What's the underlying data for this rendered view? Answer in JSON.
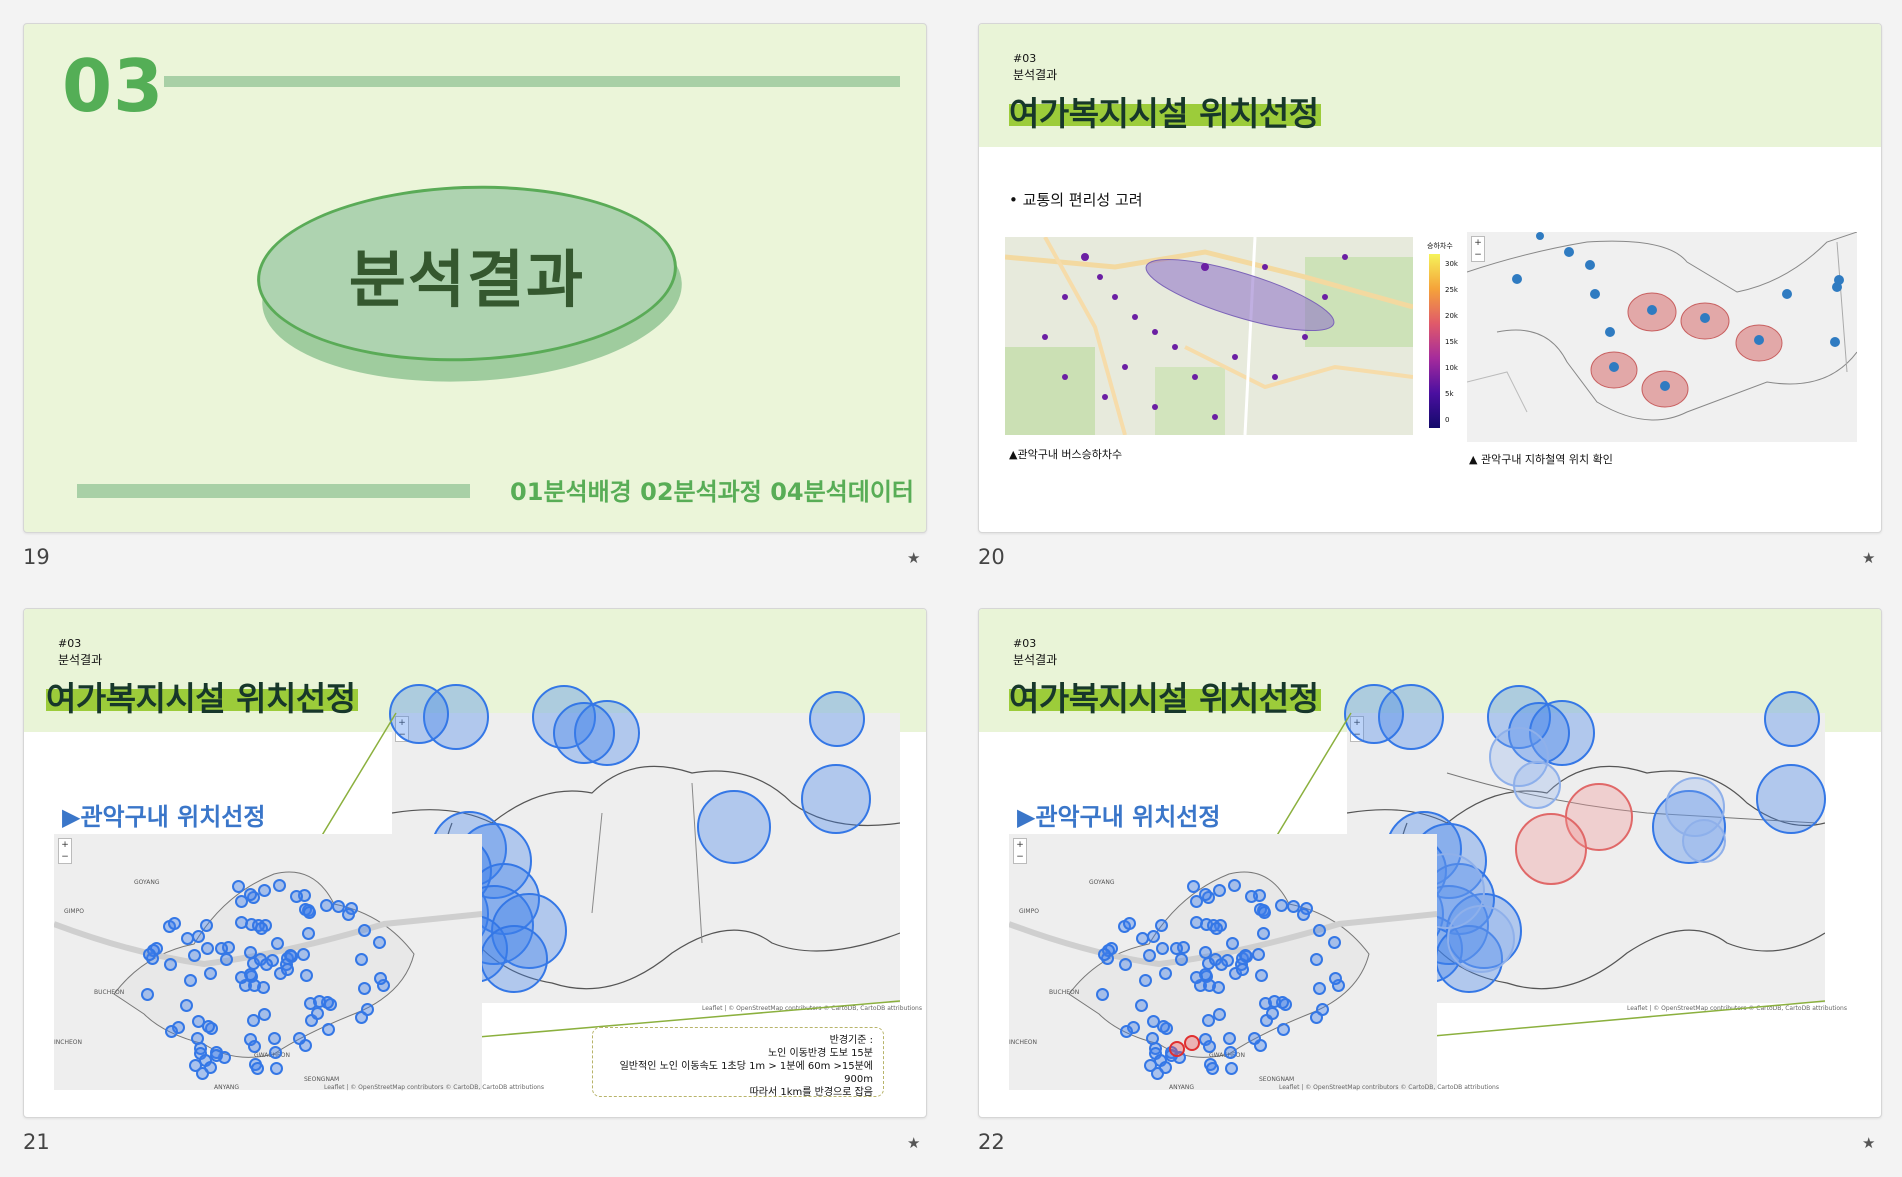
{
  "slides": [
    {
      "number": "19",
      "section_number": "03",
      "title": "분석결과",
      "links": "01분석배경 02분석과정 04분석데이터"
    },
    {
      "number": "20",
      "code": "#03",
      "subtitle": "분석결과",
      "title": "여가복지시설 위치선정",
      "bullet": "• 교통의 편리성 고려",
      "caption_left": "▲관악구내 버스승하차수",
      "caption_right": "▲ 관악구내 지하철역 위치 확인",
      "colorbar_title": "승하차수",
      "colorbar_ticks": [
        "30k",
        "25k",
        "20k",
        "15k",
        "10k",
        "5k",
        "0"
      ]
    },
    {
      "number": "21",
      "code": "#03",
      "subtitle": "분석결과",
      "title": "여가복지시설 위치선정",
      "section_heading": "▶관악구내 위치선정",
      "criteria": [
        "반경기준 :",
        "노인 이동반경 도보 15분",
        "일반적인 노인 이동속도 1초당 1m > 1분에 60m >15분에 900m",
        "따라서 1km를 반경으로 잡음"
      ],
      "map_labels": [
        "GOYANG",
        "GIMPO",
        "BUCHEON",
        "INCHEON",
        "SEONGNAM",
        "GWACHEON",
        "ANYANG"
      ],
      "attribution": "Leaflet | © OpenStreetMap contributors © CartoDB, CartoDB attributions"
    },
    {
      "number": "22",
      "code": "#03",
      "subtitle": "분석결과",
      "title": "여가복지시설 위치선정",
      "section_heading": "▶관악구내 위치선정",
      "map_labels": [
        "GOYANG",
        "GIMPO",
        "BUCHEON",
        "INCHEON",
        "SEONGNAM",
        "GWACHEON",
        "ANYANG"
      ],
      "attribution": "Leaflet | © OpenStreetMap contributors © CartoDB, CartoDB attributions"
    }
  ],
  "star_icon": "★",
  "colors": {
    "accent_green": "#54ae56",
    "highlight": "#9ccc3a",
    "circle_blue": "#3477e6",
    "circle_red": "#e06868"
  }
}
